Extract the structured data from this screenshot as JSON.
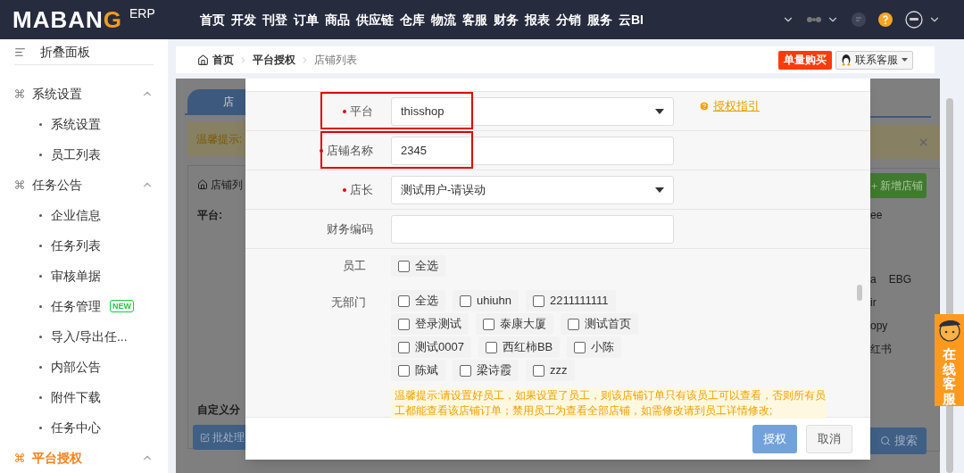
{
  "header": {
    "logo": {
      "text": "MABAN",
      "mark": "G",
      "suffix": "ERP"
    },
    "nav": [
      "首页",
      "开发",
      "刊登",
      "订单",
      "商品",
      "供应链",
      "仓库",
      "物流",
      "客服",
      "财务",
      "报表",
      "分销",
      "服务",
      "云BI"
    ]
  },
  "sidebar": {
    "collapse_label": "折叠面板",
    "groups": [
      {
        "label": "系统设置",
        "expanded": true,
        "selected": false,
        "items": [
          {
            "label": "系统设置"
          },
          {
            "label": "员工列表"
          }
        ]
      },
      {
        "label": "任务公告",
        "expanded": true,
        "selected": false,
        "items": [
          {
            "label": "企业信息"
          },
          {
            "label": "任务列表"
          },
          {
            "label": "审核单据"
          },
          {
            "label": "任务管理",
            "badge": "NEW"
          },
          {
            "label": "导入/导出任..."
          },
          {
            "label": "内部公告"
          },
          {
            "label": "附件下载"
          },
          {
            "label": "任务中心"
          }
        ]
      },
      {
        "label": "平台授权",
        "expanded": true,
        "selected": true
      }
    ]
  },
  "breadcrumb": {
    "items": [
      "首页",
      "平台授权",
      "店铺列表"
    ],
    "buy_button": "单量购买",
    "support_button": "联系客服"
  },
  "background_page": {
    "tab": "店",
    "notice": "温馨提示:",
    "panel_title": "店铺列",
    "platform_label": "平台:",
    "custom_label": "自定义分",
    "batch_button": "批处理",
    "add_button": "新增店铺",
    "fragments": [
      "ee",
      "a",
      "EBG",
      "ir",
      "opy",
      "红书"
    ],
    "search_button": "搜索"
  },
  "dialog": {
    "fields": [
      {
        "label": "平台",
        "required": true,
        "kind": "select",
        "value": "thisshop",
        "highlighted": true
      },
      {
        "label": "店铺名称",
        "required": true,
        "kind": "text",
        "value": "2345",
        "highlighted": true
      },
      {
        "label": "店长",
        "required": true,
        "kind": "select",
        "value": "测试用户-请误动",
        "highlighted": false
      },
      {
        "label": "财务编码",
        "required": false,
        "kind": "text",
        "highlighted": false
      }
    ],
    "help_link": "授权指引",
    "staff": {
      "label": "员工",
      "select_all": {
        "label": "全选",
        "checked": false
      }
    },
    "department": {
      "label": "无部门",
      "members": [
        {
          "label": "全选",
          "checked": false
        },
        {
          "label": "uhiuhn",
          "checked": false
        },
        {
          "label": "2211111111",
          "checked": false
        },
        {
          "label": "登录测试",
          "checked": false
        },
        {
          "label": "泰康大厦",
          "checked": false
        },
        {
          "label": "测试首页",
          "checked": false
        },
        {
          "label": "测试0007",
          "checked": false
        },
        {
          "label": "西红柿BB",
          "checked": false
        },
        {
          "label": "小陈",
          "checked": false
        },
        {
          "label": "陈斌",
          "checked": false
        },
        {
          "label": "梁诗霞",
          "checked": false
        },
        {
          "label": "zzz",
          "checked": false
        }
      ]
    },
    "notice": "温馨提示:请设置好员工，如果设置了员工，则该店铺订单只有该员工可以查看，否则所有员工都能查看该店铺订单；禁用员工为查看全部店铺，如需修改请到员工详情修改;",
    "buttons": [
      {
        "label": "授权",
        "kind": "primary"
      },
      {
        "label": "取消",
        "kind": "default"
      }
    ]
  },
  "float_widget": {
    "label": "在线客服"
  }
}
